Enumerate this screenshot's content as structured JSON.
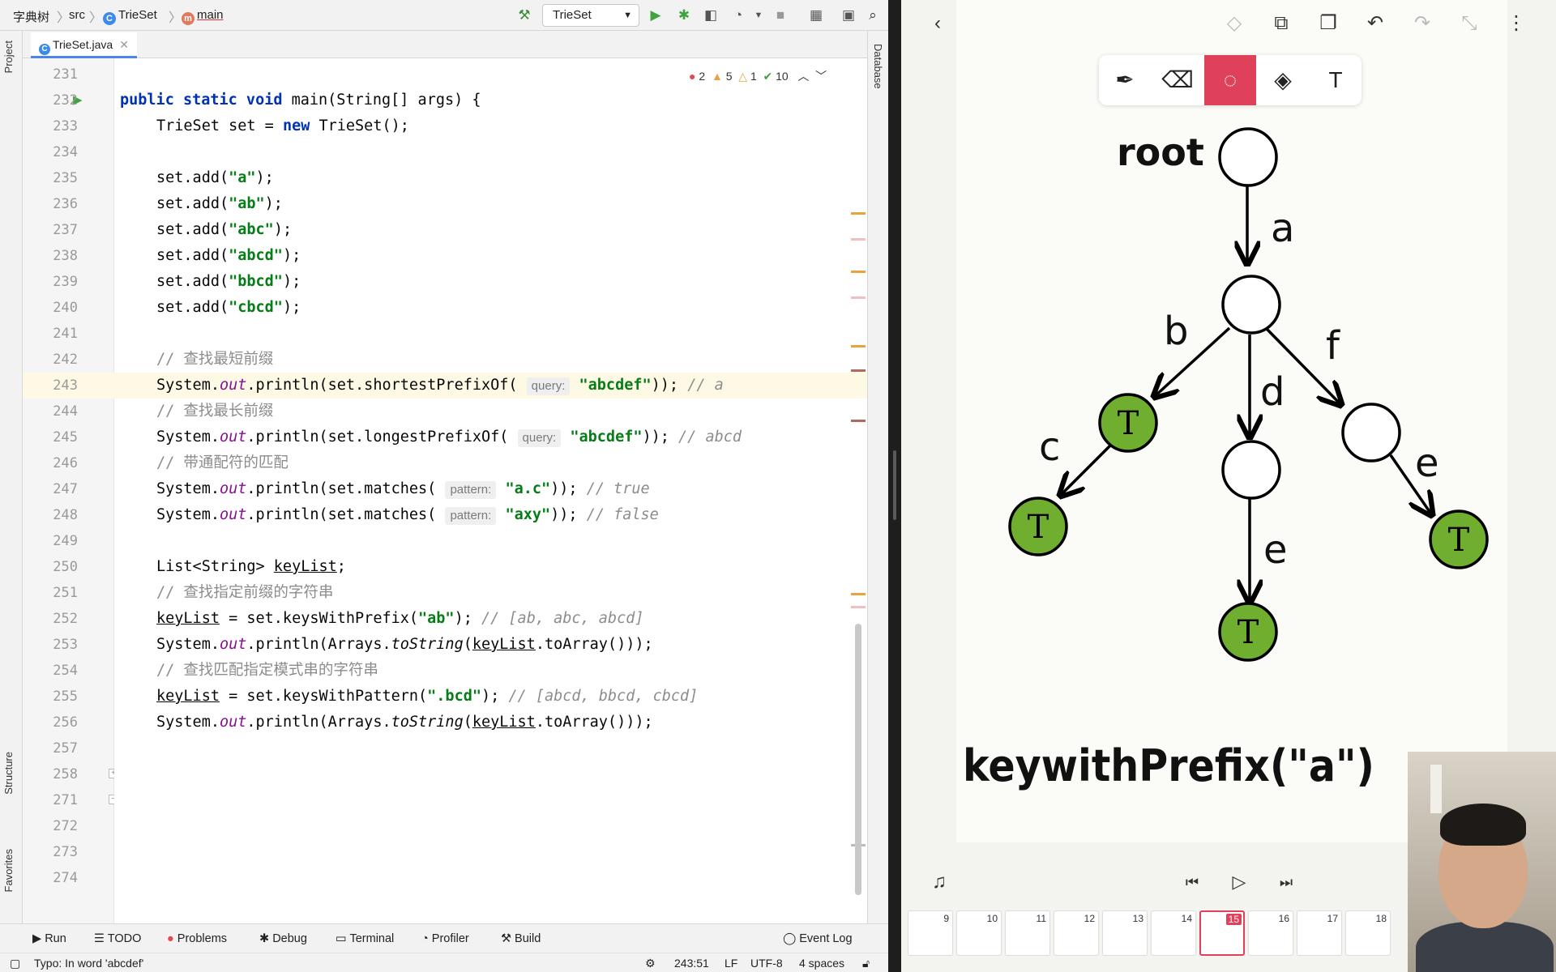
{
  "ide": {
    "breadcrumbs": [
      "字典树",
      "src",
      "TrieSet",
      "main"
    ],
    "run_config": "TrieSet",
    "tab": "TrieSet.java",
    "left_tools": [
      "Project",
      "Structure",
      "Favorites"
    ],
    "right_tools": [
      "Database"
    ],
    "inspections": {
      "errors": "2",
      "warnings": "5",
      "weak_warnings": "1",
      "ok": "10"
    },
    "lines": [
      {
        "n": "231",
        "html": ""
      },
      {
        "n": "232",
        "html": "<span class=\"kw\">public static void</span> main(String[] args) {",
        "indent": -1
      },
      {
        "n": "233",
        "html": "TrieSet set = <span class=\"kw\">new</span> TrieSet();"
      },
      {
        "n": "234",
        "html": ""
      },
      {
        "n": "235",
        "html": "set.add(<span class=\"str\">\"a\"</span>);"
      },
      {
        "n": "236",
        "html": "set.add(<span class=\"str\">\"ab\"</span>);"
      },
      {
        "n": "237",
        "html": "set.add(<span class=\"str\">\"abc\"</span>);"
      },
      {
        "n": "238",
        "html": "set.add(<span class=\"str\">\"abcd\"</span>);"
      },
      {
        "n": "239",
        "html": "set.add(<span class=\"str\">\"bbcd\"</span>);"
      },
      {
        "n": "240",
        "html": "set.add(<span class=\"str\">\"cbcd\"</span>);"
      },
      {
        "n": "241",
        "html": ""
      },
      {
        "n": "242",
        "html": "<span class=\"cmz\">// 查找最短前缀</span>"
      },
      {
        "n": "243",
        "html": "System.<span class=\"it\">out</span>.println(set.shortestPrefixOf( <span class=\"hint\">query:</span> <span class=\"str\">\"abcdef\"</span>)); <span class=\"cm\">// a</span>",
        "hl": true
      },
      {
        "n": "244",
        "html": "<span class=\"cmz\">// 查找最长前缀</span>"
      },
      {
        "n": "245",
        "html": "System.<span class=\"it\">out</span>.println(set.longestPrefixOf( <span class=\"hint\">query:</span> <span class=\"str\">\"abcdef\"</span>)); <span class=\"cm\">// abcd</span>"
      },
      {
        "n": "246",
        "html": "<span class=\"cmz\">// 带通配符的匹配</span>"
      },
      {
        "n": "247",
        "html": "System.<span class=\"it\">out</span>.println(set.matches( <span class=\"hint\">pattern:</span> <span class=\"str\">\"a.c\"</span>)); <span class=\"cm\">// true</span>"
      },
      {
        "n": "248",
        "html": "System.<span class=\"it\">out</span>.println(set.matches( <span class=\"hint\">pattern:</span> <span class=\"str\">\"axy\"</span>)); <span class=\"cm\">// false</span>"
      },
      {
        "n": "249",
        "html": ""
      },
      {
        "n": "250",
        "html": "List&lt;String&gt; <span class=\"u\">keyList</span>;"
      },
      {
        "n": "251",
        "html": "<span class=\"cmz\">// 查找指定前缀的字符串</span>"
      },
      {
        "n": "252",
        "html": "<span class=\"u\">keyList</span> = set.keysWithPrefix(<span class=\"str\">\"ab\"</span>); <span class=\"cm\">// [ab, abc, abcd]</span>"
      },
      {
        "n": "253",
        "html": "System.<span class=\"it\">out</span>.println(Arrays.<span class=\"it\" style=\"color:#080808\">toString</span>(<span class=\"u\">keyList</span>.toArray()));"
      },
      {
        "n": "254",
        "html": "<span class=\"cmz\">// 查找匹配指定模式串的字符串</span>"
      },
      {
        "n": "255",
        "html": "<span class=\"u\">keyList</span> = set.keysWithPattern(<span class=\"str\">\".bcd\"</span>); <span class=\"cm\">// [abcd, bbcd, cbcd]</span>"
      },
      {
        "n": "256",
        "html": "System.<span class=\"it\">out</span>.println(Arrays.<span class=\"it\" style=\"color:#080808\">toString</span>(<span class=\"u\">keyList</span>.toArray()));"
      },
      {
        "n": "257",
        "html": ""
      },
      {
        "n": "258",
        "html": ""
      },
      {
        "n": "271",
        "html": ""
      },
      {
        "n": "272",
        "html": ""
      },
      {
        "n": "273",
        "html": ""
      },
      {
        "n": "274",
        "html": ""
      }
    ],
    "bottom_tools": [
      "Run",
      "TODO",
      "Problems",
      "Debug",
      "Terminal",
      "Profiler",
      "Build",
      "Event Log"
    ],
    "status": {
      "message": "Typo: In word 'abcdef'",
      "position": "243:51",
      "line_sep": "LF",
      "encoding": "UTF-8",
      "indent": "4 spaces"
    }
  },
  "board": {
    "tools": [
      "pen",
      "eraser",
      "lasso",
      "fill",
      "text"
    ],
    "active_tool": "lasso",
    "handwriting": {
      "root": "root",
      "formula": "keywithPrefix(\"a\")"
    },
    "edge_labels": [
      "a",
      "b",
      "d",
      "f",
      "c",
      "e",
      "e"
    ],
    "terminal_label": "T",
    "pages": [
      "9",
      "10",
      "11",
      "12",
      "13",
      "14",
      "15",
      "16",
      "17",
      "18"
    ],
    "current_page": "15",
    "colors": {
      "accent": "#e0415a",
      "node_fill": "#6fae2f"
    }
  }
}
